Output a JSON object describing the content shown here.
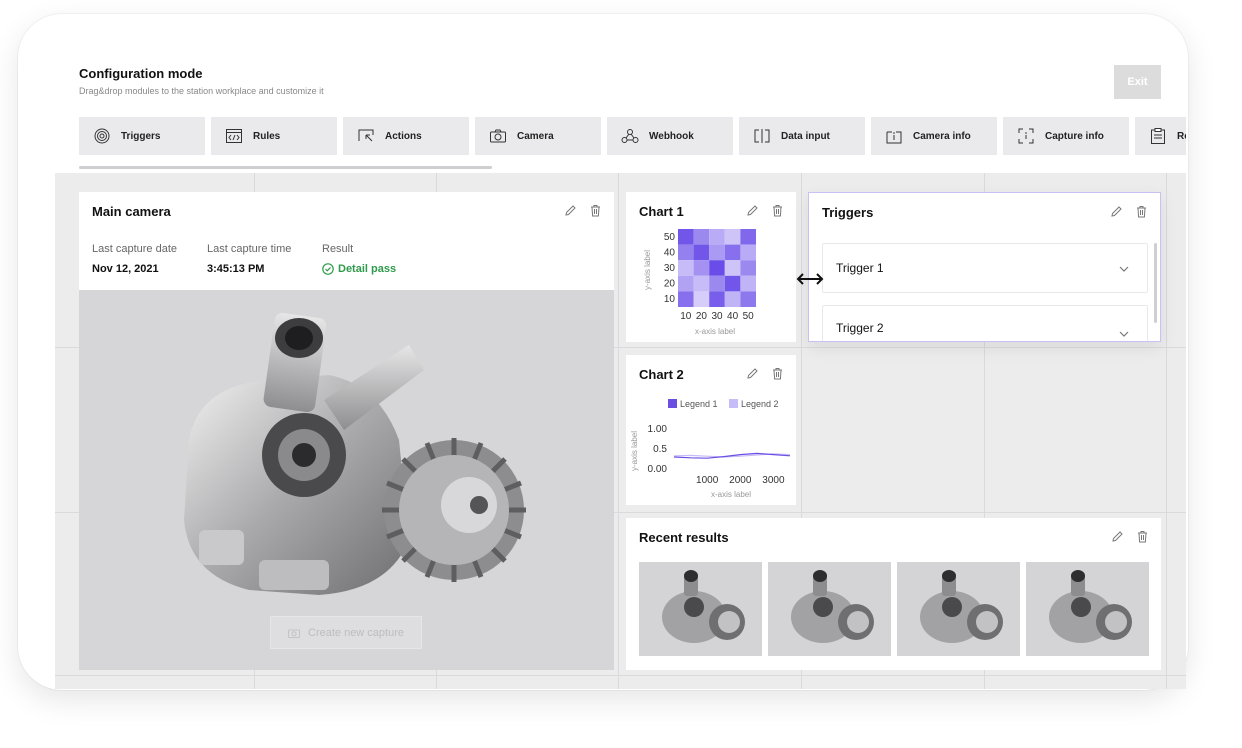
{
  "header": {
    "title": "Configuration mode",
    "subtitle": "Drag&drop modules to the station workplace and customize it",
    "exit_label": "Exit"
  },
  "modules": [
    {
      "label": "Triggers",
      "icon": "target-icon"
    },
    {
      "label": "Rules",
      "icon": "code-icon"
    },
    {
      "label": "Actions",
      "icon": "cursor-icon"
    },
    {
      "label": "Camera",
      "icon": "camera-icon"
    },
    {
      "label": "Webhook",
      "icon": "webhook-icon"
    },
    {
      "label": "Data input",
      "icon": "data-input-icon"
    },
    {
      "label": "Camera info",
      "icon": "info-icon"
    },
    {
      "label": "Capture info",
      "icon": "capture-info-icon"
    },
    {
      "label": "Re",
      "icon": "clipboard-icon"
    }
  ],
  "main_camera": {
    "title": "Main camera",
    "last_capture_date_label": "Last capture date",
    "last_capture_date": "Nov 12, 2021",
    "last_capture_time_label": "Last capture time",
    "last_capture_time": "3:45:13 PM",
    "result_label": "Result",
    "result_value": "Detail pass",
    "create_capture_label": "Create new capture"
  },
  "triggers_panel": {
    "title": "Triggers",
    "items": [
      "Trigger 1",
      "Trigger 2"
    ]
  },
  "recent_results": {
    "title": "Recent results"
  },
  "colors": {
    "accent": "#6b4fe3",
    "pass": "#2e9a4b",
    "selection_border": "#c9c1f5"
  },
  "chart_data": [
    {
      "type": "heatmap",
      "title": "Chart 1",
      "xlabel": "x-axis label",
      "ylabel": "y-axis label",
      "x": [
        10,
        20,
        30,
        40,
        50
      ],
      "y": [
        10,
        20,
        30,
        40,
        50
      ],
      "values": [
        [
          0.85,
          0.55,
          0.35,
          0.2,
          0.75
        ],
        [
          0.6,
          0.85,
          0.45,
          0.7,
          0.35
        ],
        [
          0.25,
          0.5,
          0.9,
          0.2,
          0.55
        ],
        [
          0.4,
          0.25,
          0.55,
          0.85,
          0.3
        ],
        [
          0.7,
          0.15,
          0.8,
          0.3,
          0.65
        ]
      ]
    },
    {
      "type": "line",
      "title": "Chart 2",
      "xlabel": "x-axis label",
      "ylabel": "y-axis label",
      "ylim": [
        0,
        1
      ],
      "xlim": [
        0,
        3500
      ],
      "y_ticks": [
        "1.00",
        "0.5",
        "0.00"
      ],
      "x_ticks": [
        "1000",
        "2000",
        "3000"
      ],
      "series": [
        {
          "name": "Legend 1",
          "color": "#6b4fe3",
          "x": [
            0,
            500,
            1000,
            1500,
            2000,
            2500,
            3000,
            3500
          ],
          "y": [
            0.3,
            0.28,
            0.27,
            0.31,
            0.36,
            0.39,
            0.36,
            0.33
          ]
        },
        {
          "name": "Legend 2",
          "color": "#c6bcf7",
          "x": [
            0,
            500,
            1000,
            1500,
            2000,
            2500,
            3000,
            3500
          ],
          "y": [
            0.33,
            0.34,
            0.32,
            0.3,
            0.32,
            0.35,
            0.38,
            0.36
          ]
        }
      ]
    }
  ]
}
